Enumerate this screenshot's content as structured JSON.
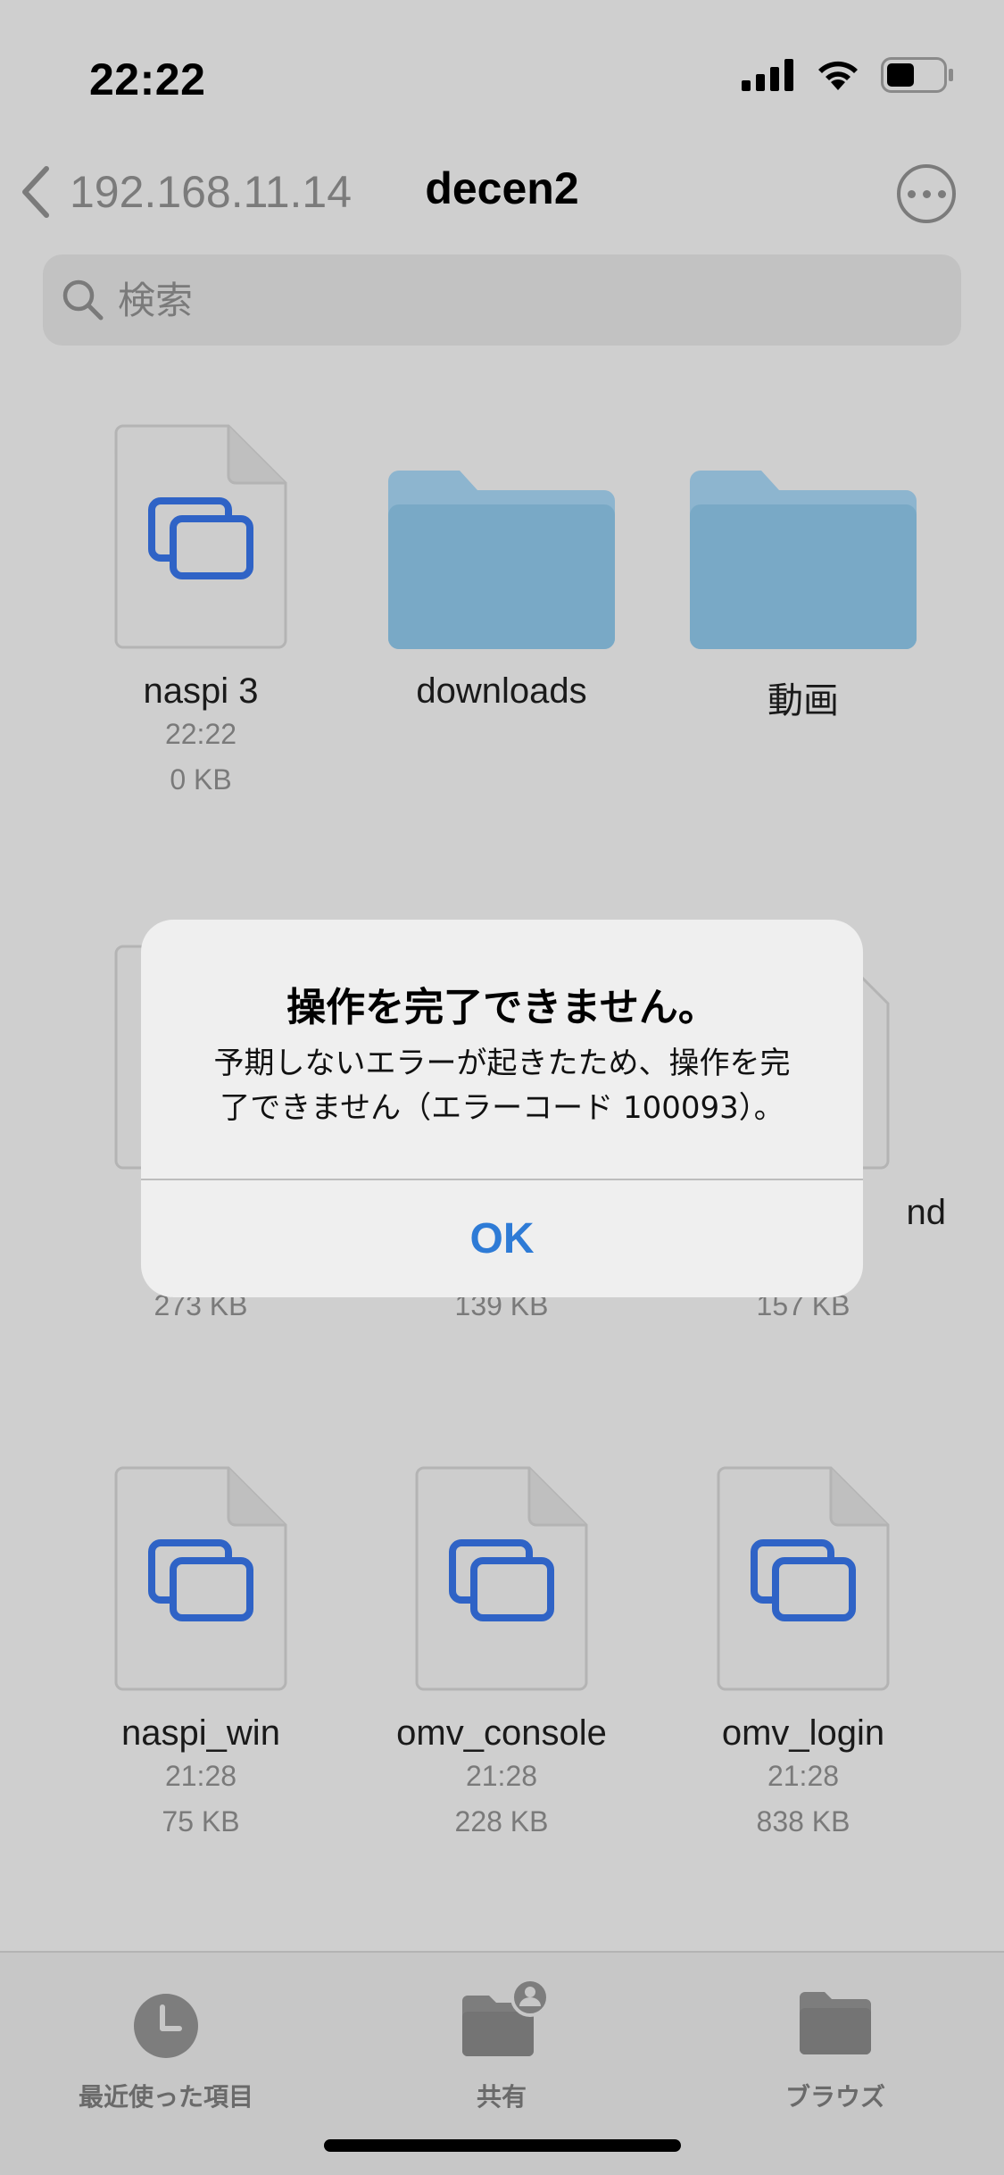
{
  "status_bar": {
    "time": "22:22"
  },
  "nav": {
    "back_label": "192.168.11.14",
    "title": "decen2"
  },
  "search": {
    "placeholder": "検索"
  },
  "items": [
    {
      "name": "naspi 3",
      "time": "22:22",
      "size": "0 KB",
      "kind": "document"
    },
    {
      "name": "downloads",
      "kind": "folder"
    },
    {
      "name": "動画",
      "kind": "folder"
    },
    {
      "name": "",
      "size": "273 KB",
      "kind": "document"
    },
    {
      "name": "",
      "size": "139 KB",
      "kind": "document"
    },
    {
      "name": "nd",
      "size": "157 KB",
      "kind": "document"
    },
    {
      "name": "naspi_win",
      "time": "21:28",
      "size": "75 KB",
      "kind": "document"
    },
    {
      "name": "omv_console",
      "time": "21:28",
      "size": "228 KB",
      "kind": "document"
    },
    {
      "name": "omv_login",
      "time": "21:28",
      "size": "838 KB",
      "kind": "document"
    }
  ],
  "alert": {
    "title": "操作を完了できません。",
    "message_line1": "予期しないエラーが起きたため、操作を完",
    "message_line2": "了できません（エラーコード 100093）。",
    "ok_label": "OK"
  },
  "tab_bar": {
    "tabs": [
      {
        "label": "最近使った項目",
        "icon": "clock-icon"
      },
      {
        "label": "共有",
        "icon": "shared-folder-icon"
      },
      {
        "label": "ブラウズ",
        "icon": "folder-icon"
      }
    ]
  },
  "colors": {
    "background": "#cfcfcf",
    "folder": "#79a9c6",
    "doc_icon": "#2f63c6",
    "alert_button": "#2e7bd6"
  }
}
